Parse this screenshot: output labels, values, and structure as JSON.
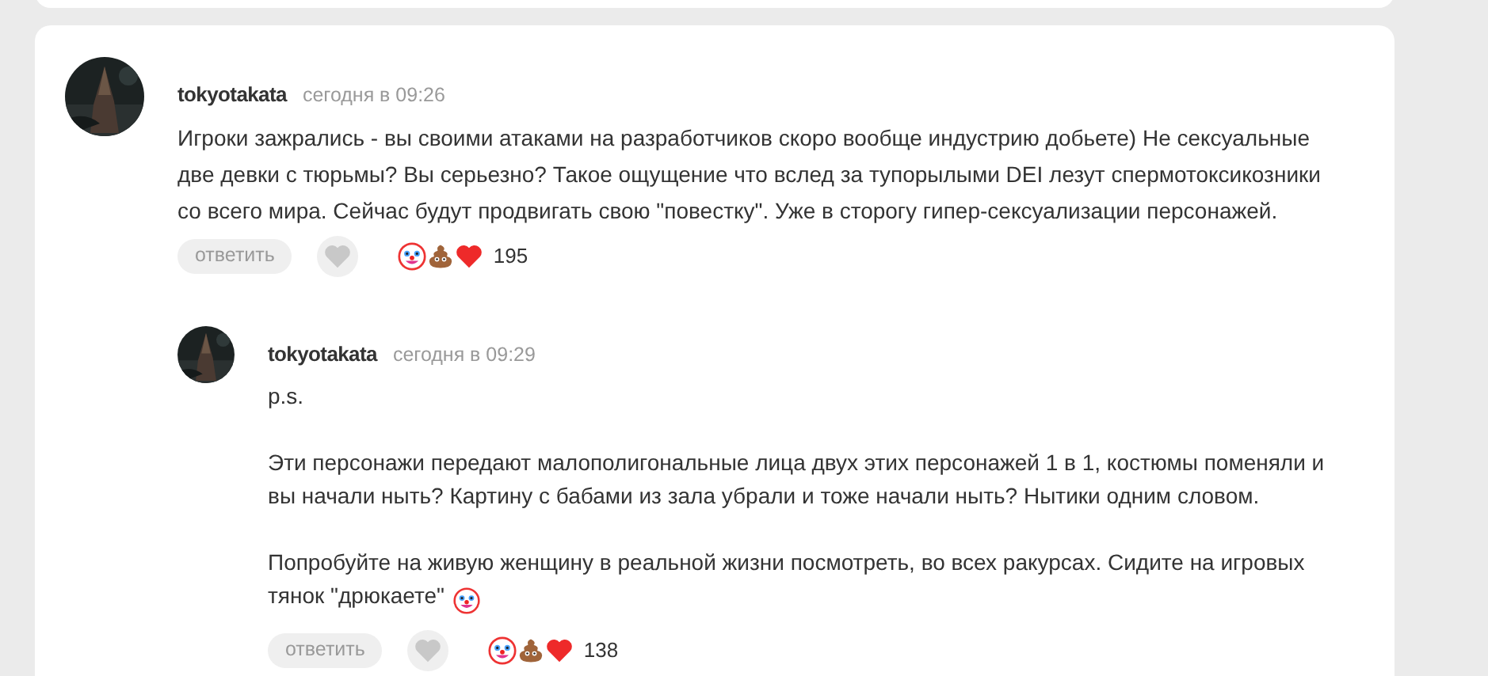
{
  "comments": [
    {
      "author": "tokyotakata",
      "time": "сегодня в 09:26",
      "paragraphs": [
        "Игроки зажрались - вы своими атаками на разработчиков скоро вообще индустрию добьете) Не сексуальные две девки с тюрьмы? Вы серьезно? Такое ощущение что вслед за тупорылыми DEI лезут спермотоксикозники со всего мира. Сейчас будут продвигать свою \"повестку\". Уже в сторогу гипер-сексуализации персонажей."
      ],
      "reply_label": "ответить",
      "reaction_count": "195",
      "replies": [
        {
          "author": "tokyotakata",
          "time": "сегодня в 09:29",
          "paragraphs": [
            "p.s.",
            "Эти персонажи передают малополигональные лица двух этих персонажей 1 в 1, костюмы поменяли и вы начали ныть? Картину с бабами из зала убрали и тоже начали ныть? Нытики одним словом.",
            "Попробуйте на живую женщину в реальной жизни посмотреть, во всех ракурсах. Сидите на игровых тянок \"дрюкаете\""
          ],
          "trailing_emoji": true,
          "reply_label": "ответить",
          "reaction_count": "138"
        }
      ]
    }
  ]
}
